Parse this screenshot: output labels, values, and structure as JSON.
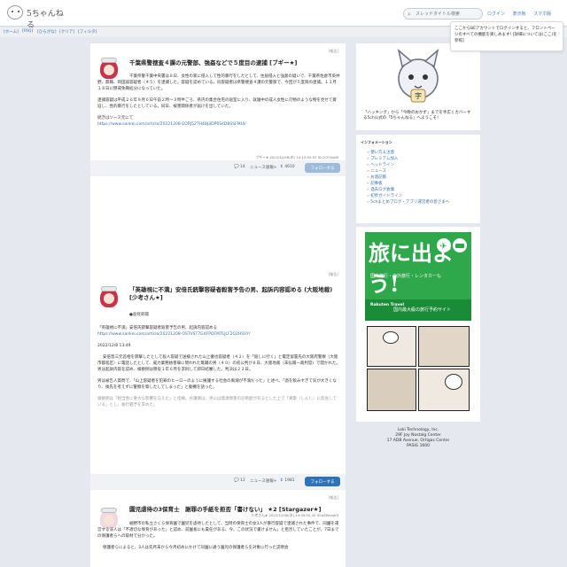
{
  "header": {
    "logo_text": "5ちゃんねる",
    "search_placeholder": "スレッドタイトル検索",
    "links": [
      "ログイン",
      "表示板",
      "スマホ版"
    ]
  },
  "nav": [
    "[ホーム]",
    "[FAQ]",
    "[ひらがな]",
    "[クリア]",
    "[フィルタ]"
  ],
  "tooltip": {
    "text": "ここからBEアカウントでログインすると、フロントページのすべての機能を楽しめます! [詳細については(ここ)を参照]"
  },
  "threads": [
    {
      "report": "[報告]",
      "title": "千葉県警捜査４課の元警部、強姦などで５度目の逮捕 [ブギー★]",
      "paragraphs": [
        "千葉県警千葉中央署は８日、女性の家に侵入して性的暴行をしたとして、住居侵入と強姦の疑いで、千葉県佐倉市染井野、無職、岡田誠容疑者（４５）を逮捕した。容疑を認めている。同容疑者は県警捜査４課の元警部で、今回が５度目の逮捕。１１月１８日に懲戒免職処分になっていた。",
        "逮捕容疑は平成２６年９月６日午前２時～３時半ごろ、県内の集合住宅の居室に入り、就寝中の成人女性に刃物のような物を見せて脅迫し、性的暴行をしたとしている。同日、被害関係者が届けを出していた。",
        "続きはソース元にて"
      ],
      "url": "https://www.sankei.com/article/20221208-EORJ52TH4BJ3DP6S4DBSSFMUI/",
      "meta": "ブギー★ 2022/12/08(木) 14:15:50.97 ID:1CF0holB",
      "comments": "14",
      "news_label": "ニュース速報+",
      "views": "4610",
      "follow_label": "フォローする"
    },
    {
      "report": "[報告]",
      "title": "「英雄視に不満」安倍氏銃撃容疑者殺害予告の男、起訴内容認める (大阪地裁) [少考さん★]",
      "source": "●産経新聞",
      "quote_title": "「英雄視に不満」安倍氏銃撃容疑者殺害予告の男、起訴内容認める",
      "url": "https://www.sankei.com/article/20221208-OSTVST7GXFPDFMTLJLF2Q2HSVY/",
      "date": "2022/12/8 13:49",
      "paragraphs": [
        "安倍晋三元首相を銃撃したとして殺人容疑で送検された山上徹也容疑者（４２）を「殺しに行く」と電定留置先の大阪府警察（大阪市都島区）に電話したとして、威力業務妨害罪に問われた無職の男（４０）の初公判が８日、大阪地裁（末弘陽一裁判官）で開かれた。男は起訴内容を認め、検察側は懲役１年６月を求刑して即日結審した。判決は２２日。",
        "男は被告人質問で、「山上容疑者を犯罪のヒーローのように擁護する社会の風潮が不満だった」と述べ、「酒を飲みすぎて気が大きくなり、後先を考えずに警察を脅したしてしまった」と動機を語った。",
        "検察側は「相当性に重大な影響を与えた」と指摘。弁護側は、男には発達障害の診断歴があるとした上で「真摯（しんし）に反省している」とし、執行猶予を求めた。"
      ],
      "meta": "少考さん★ 2022/12/08(木) 14:09:50.40 ID:qSWxvjK9",
      "comments": "12",
      "news_label": "ニュース速報+",
      "views": "1981",
      "follow_label": "フォローする"
    },
    {
      "report": "[報告]",
      "title": "園児虐待の3保育士　謝罪の手紙を拒否「書けない」 ★2 [Stargazer★]",
      "paragraphs": [
        "裾野市の私立さくら保育園で園児を虐待したとして、当時の保育士の女3人が暴行容疑で逮捕された事件で、同園を運営する法人は「不適切な保育があった」と認め、前園長にも責任がある、今、この状況で書けません」と拒否していたことが、7日までの保護者らへの取材で分かった。",
        "保護者らによると、3人は先月末から今月初めにかけて同園に通う園児の保護者らを対象に行った説明会"
      ]
    }
  ],
  "sidebar": {
    "mascot_caption": "「ハッキング」から「今晩のおかず」までを手広くカバーする5ch公式の「5ちゃんねる」へようこそ！",
    "info_title": "インフォメーション",
    "info_items": [
      "使い方＆注意",
      "プレミアム加入",
      "ヘッドライン",
      "ニュース",
      "お酒記帳",
      "記事板",
      "過去ログ倉庫",
      "初歩ガイドライン",
      "5chまとめブログ・アプリ運営者の皆さまへ"
    ],
    "ad": {
      "headline": "旅に出よう!",
      "subline": "国内旅行・海外旅行・レンタカーも",
      "brand": "Rakuten Travel",
      "tagline": "国内最大級の旅行予約サイト"
    },
    "corp": [
      "Loki Technology, Inc.",
      "29F Joy Nostalg Center",
      "17 ADB Avenue, Ortigas Center",
      "PASIG 1600"
    ]
  }
}
